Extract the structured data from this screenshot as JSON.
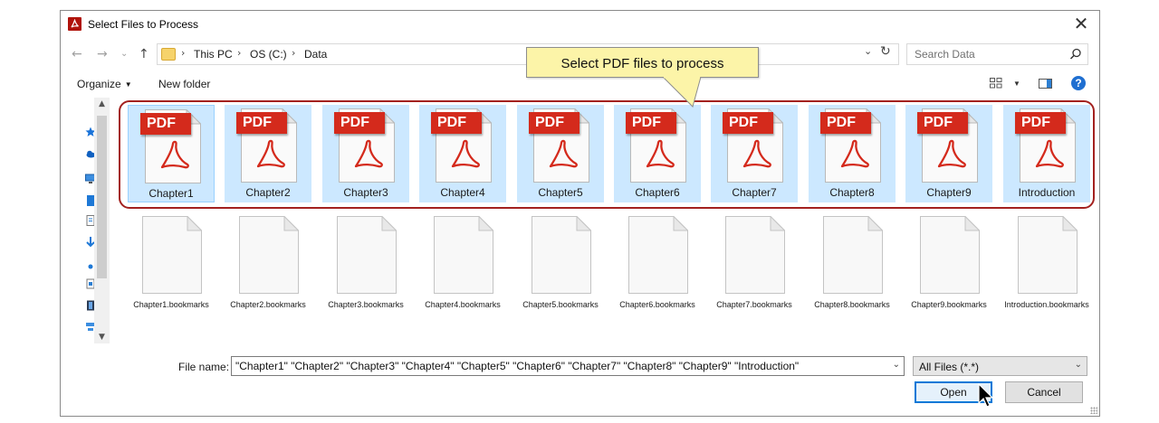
{
  "window": {
    "title": "Select Files to Process",
    "close_label": "✕"
  },
  "address": {
    "crumbs": [
      "This PC",
      "OS (C:)",
      "Data"
    ],
    "search_placeholder": "Search Data"
  },
  "toolbar": {
    "organize_label": "Organize",
    "new_folder_label": "New folder",
    "help_label": "?"
  },
  "callout": {
    "text": "Select PDF files to process"
  },
  "pdf_files": [
    {
      "name": "Chapter1"
    },
    {
      "name": "Chapter2"
    },
    {
      "name": "Chapter3"
    },
    {
      "name": "Chapter4"
    },
    {
      "name": "Chapter5"
    },
    {
      "name": "Chapter6"
    },
    {
      "name": "Chapter7"
    },
    {
      "name": "Chapter8"
    },
    {
      "name": "Chapter9"
    },
    {
      "name": "Introduction"
    }
  ],
  "pdf_badge": "PDF",
  "bookmark_files": [
    {
      "name": "Chapter1.bookmarks"
    },
    {
      "name": "Chapter2.bookmarks"
    },
    {
      "name": "Chapter3.bookmarks"
    },
    {
      "name": "Chapter4.bookmarks"
    },
    {
      "name": "Chapter5.bookmarks"
    },
    {
      "name": "Chapter6.bookmarks"
    },
    {
      "name": "Chapter7.bookmarks"
    },
    {
      "name": "Chapter8.bookmarks"
    },
    {
      "name": "Chapter9.bookmarks"
    },
    {
      "name": "Introduction.bookmarks"
    }
  ],
  "footer": {
    "file_name_label": "File name:",
    "file_name_value": "\"Chapter1\" \"Chapter2\" \"Chapter3\" \"Chapter4\" \"Chapter5\" \"Chapter6\" \"Chapter7\" \"Chapter8\" \"Chapter9\" \"Introduction\"",
    "filter_value": "All Files (*.*)",
    "open_label": "Open",
    "cancel_label": "Cancel"
  },
  "colors": {
    "selection": "#cce8ff",
    "pdf_red": "#d42a1c",
    "highlight_frame": "#a3211f",
    "callout_bg": "#fcf4a8",
    "accent": "#0078d7"
  }
}
